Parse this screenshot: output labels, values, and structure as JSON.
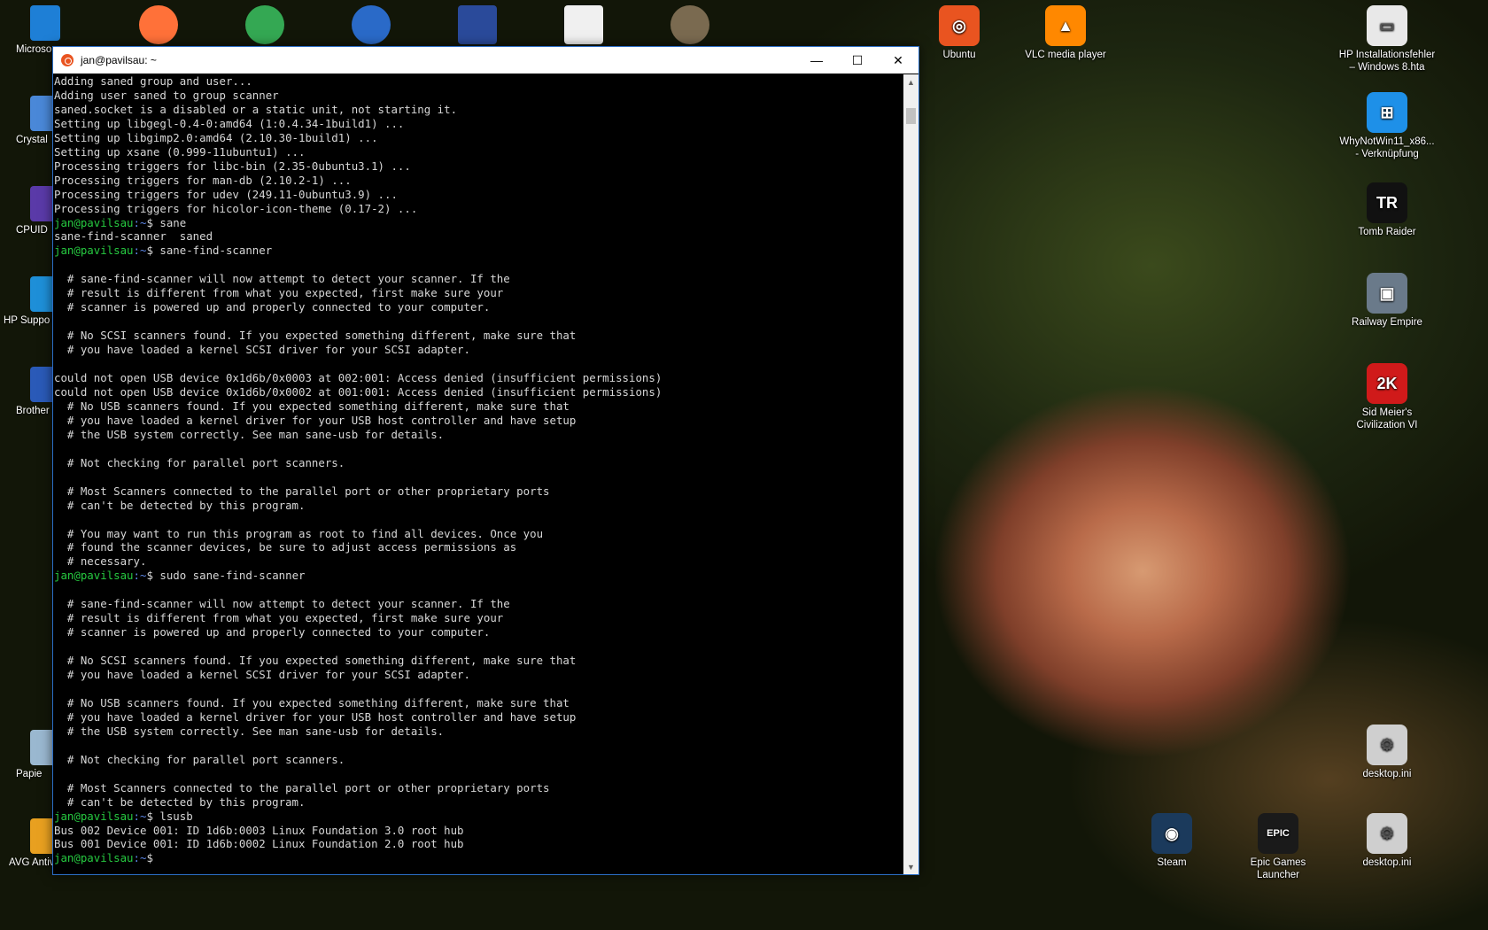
{
  "window": {
    "title": "jan@pavilsau: ~",
    "minimize_glyph": "—",
    "maximize_glyph": "☐",
    "close_glyph": "✕"
  },
  "terminal": {
    "lines": [
      {
        "text": "Adding saned group and user..."
      },
      {
        "text": "Adding user saned to group scanner"
      },
      {
        "text": "saned.socket is a disabled or a static unit, not starting it."
      },
      {
        "text": "Setting up libgegl-0.4-0:amd64 (1:0.4.34-1build1) ..."
      },
      {
        "text": "Setting up libgimp2.0:amd64 (2.10.30-1build1) ..."
      },
      {
        "text": "Setting up xsane (0.999-11ubuntu1) ..."
      },
      {
        "text": "Processing triggers for libc-bin (2.35-0ubuntu3.1) ..."
      },
      {
        "text": "Processing triggers for man-db (2.10.2-1) ..."
      },
      {
        "text": "Processing triggers for udev (249.11-0ubuntu3.9) ..."
      },
      {
        "text": "Processing triggers for hicolor-icon-theme (0.17-2) ..."
      },
      {
        "user": "jan@pavilsau",
        "path": ":~",
        "cmd": "$ sane"
      },
      {
        "text": "sane-find-scanner  saned"
      },
      {
        "user": "jan@pavilsau",
        "path": ":~",
        "cmd": "$ sane-find-scanner"
      },
      {
        "text": ""
      },
      {
        "text": "  # sane-find-scanner will now attempt to detect your scanner. If the"
      },
      {
        "text": "  # result is different from what you expected, first make sure your"
      },
      {
        "text": "  # scanner is powered up and properly connected to your computer."
      },
      {
        "text": ""
      },
      {
        "text": "  # No SCSI scanners found. If you expected something different, make sure that"
      },
      {
        "text": "  # you have loaded a kernel SCSI driver for your SCSI adapter."
      },
      {
        "text": ""
      },
      {
        "text": "could not open USB device 0x1d6b/0x0003 at 002:001: Access denied (insufficient permissions)"
      },
      {
        "text": "could not open USB device 0x1d6b/0x0002 at 001:001: Access denied (insufficient permissions)"
      },
      {
        "text": "  # No USB scanners found. If you expected something different, make sure that"
      },
      {
        "text": "  # you have loaded a kernel driver for your USB host controller and have setup"
      },
      {
        "text": "  # the USB system correctly. See man sane-usb for details."
      },
      {
        "text": ""
      },
      {
        "text": "  # Not checking for parallel port scanners."
      },
      {
        "text": ""
      },
      {
        "text": "  # Most Scanners connected to the parallel port or other proprietary ports"
      },
      {
        "text": "  # can't be detected by this program."
      },
      {
        "text": ""
      },
      {
        "text": "  # You may want to run this program as root to find all devices. Once you"
      },
      {
        "text": "  # found the scanner devices, be sure to adjust access permissions as"
      },
      {
        "text": "  # necessary."
      },
      {
        "user": "jan@pavilsau",
        "path": ":~",
        "cmd": "$ sudo sane-find-scanner"
      },
      {
        "text": ""
      },
      {
        "text": "  # sane-find-scanner will now attempt to detect your scanner. If the"
      },
      {
        "text": "  # result is different from what you expected, first make sure your"
      },
      {
        "text": "  # scanner is powered up and properly connected to your computer."
      },
      {
        "text": ""
      },
      {
        "text": "  # No SCSI scanners found. If you expected something different, make sure that"
      },
      {
        "text": "  # you have loaded a kernel SCSI driver for your SCSI adapter."
      },
      {
        "text": ""
      },
      {
        "text": "  # No USB scanners found. If you expected something different, make sure that"
      },
      {
        "text": "  # you have loaded a kernel driver for your USB host controller and have setup"
      },
      {
        "text": "  # the USB system correctly. See man sane-usb for details."
      },
      {
        "text": ""
      },
      {
        "text": "  # Not checking for parallel port scanners."
      },
      {
        "text": ""
      },
      {
        "text": "  # Most Scanners connected to the parallel port or other proprietary ports"
      },
      {
        "text": "  # can't be detected by this program."
      },
      {
        "user": "jan@pavilsau",
        "path": ":~",
        "cmd": "$ lsusb"
      },
      {
        "text": "Bus 002 Device 001: ID 1d6b:0003 Linux Foundation 3.0 root hub"
      },
      {
        "text": "Bus 001 Device 001: ID 1d6b:0002 Linux Foundation 2.0 root hub"
      },
      {
        "user": "jan@pavilsau",
        "path": ":~",
        "cmd": "$ "
      }
    ]
  },
  "colors": {
    "prompt_user": "#26c940",
    "prompt_path": "#5c86e6",
    "terminal_text": "#d7d7d7",
    "terminal_bg": "#000000"
  },
  "desktop_right": [
    {
      "name": "ubuntu-icon",
      "label": "Ubuntu",
      "color": "#e95420",
      "glyph": "◎"
    },
    {
      "name": "vlc-icon",
      "label": "VLC media player",
      "color": "#ff8800",
      "glyph": "▲"
    },
    {
      "name": "hp-install-icon",
      "label": "HP Installationsfehler – Windows 8.hta",
      "color": "#e8e8e8",
      "glyph": "▭"
    },
    {
      "name": "whynotwin11-icon",
      "label": "WhyNotWin11_x86... - Verknüpfung",
      "color": "#1e90e8",
      "glyph": "⊞"
    },
    {
      "name": "tomb-raider-icon",
      "label": "Tomb Raider",
      "color": "#111111",
      "glyph": "TR"
    },
    {
      "name": "railway-empire-icon",
      "label": "Railway Empire",
      "color": "#6a7a8a",
      "glyph": "▣"
    },
    {
      "name": "civilization-icon",
      "label": "Sid Meier's Civilization VI",
      "color": "#d01a1a",
      "glyph": "2K"
    },
    {
      "name": "desktop-ini-icon",
      "label": "desktop.ini",
      "color": "#cfcfcf",
      "glyph": "⚙"
    },
    {
      "name": "steam-icon",
      "label": "Steam",
      "color": "#1b3a5c",
      "glyph": "◉"
    },
    {
      "name": "epic-games-icon",
      "label": "Epic Games Launcher",
      "color": "#1a1a1a",
      "glyph": "EPIC"
    },
    {
      "name": "desktop-ini-2-icon",
      "label": "desktop.ini",
      "color": "#cfcfcf",
      "glyph": "⚙"
    }
  ],
  "desktop_left": [
    {
      "name": "microsoft-edge-icon",
      "label": "Microso",
      "color": "#1e7fd6"
    },
    {
      "name": "crystal-icon",
      "label": "Crystal",
      "color": "#4a88d8"
    },
    {
      "name": "cpuid-icon",
      "label": "CPUID",
      "color": "#5a3aa8"
    },
    {
      "name": "hp-support-icon",
      "label": "HP Suppo",
      "color": "#1e8fd8"
    },
    {
      "name": "brother-icon",
      "label": "Brother",
      "color": "#2a5ab8"
    },
    {
      "name": "recycle-bin-icon",
      "label": "Papie",
      "color": "#9ab8d0"
    },
    {
      "name": "avg-icon",
      "label": "AVG Antivirus Free",
      "color": "#e8a020"
    }
  ],
  "desktop_top": [
    {
      "name": "firefox-icon",
      "color": "#ff7139"
    },
    {
      "name": "chrome-icon",
      "color": "#34a853"
    },
    {
      "name": "thunderbird-icon",
      "color": "#2a6ac8"
    },
    {
      "name": "save-disk-icon",
      "color": "#2a4a9a"
    },
    {
      "name": "file-icon",
      "color": "#f0f0f0"
    },
    {
      "name": "gimp-icon",
      "color": "#7a6a50"
    }
  ]
}
